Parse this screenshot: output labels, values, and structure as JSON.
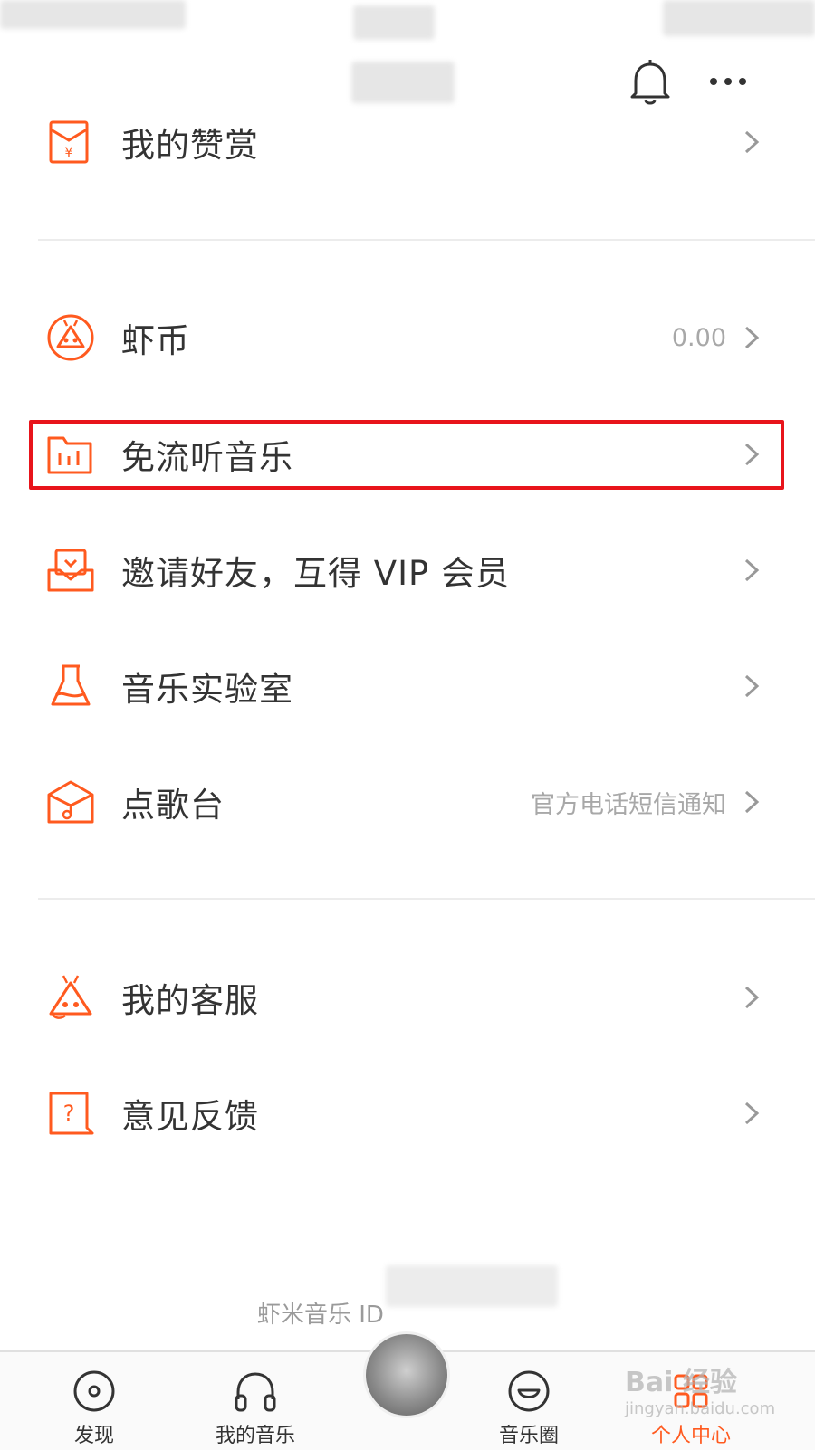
{
  "colors": {
    "accent": "#ff5a1f",
    "highlight": "#e8141b",
    "text": "#333333",
    "muted": "#a8a8a8"
  },
  "header": {
    "bell_icon": "bell-icon",
    "more_icon": "more-icon"
  },
  "menu": {
    "reward": {
      "label": "我的赞赏",
      "icon": "red-envelope-icon"
    },
    "coins": {
      "label": "虾币",
      "value": "0.00",
      "icon": "shrimp-coin-icon"
    },
    "free_data": {
      "label": "免流听音乐",
      "icon": "chart-folder-icon"
    },
    "invite": {
      "label": "邀请好友，互得 VIP 会员",
      "icon": "invite-icon"
    },
    "lab": {
      "label": "音乐实验室",
      "icon": "flask-icon"
    },
    "request": {
      "label": "点歌台",
      "value": "官方电话短信通知",
      "icon": "music-box-icon"
    },
    "service": {
      "label": "我的客服",
      "icon": "support-mascot-icon"
    },
    "feedback": {
      "label": "意见反馈",
      "icon": "question-bubble-icon"
    }
  },
  "footer": {
    "id_label": "虾米音乐 ID"
  },
  "tabs": [
    {
      "label": "发现",
      "icon": "disc-icon"
    },
    {
      "label": "我的音乐",
      "icon": "headphones-icon"
    },
    {
      "label": "",
      "icon": "album-cover"
    },
    {
      "label": "音乐圈",
      "icon": "smile-icon"
    },
    {
      "label": "个人中心",
      "icon": "profile-icon"
    }
  ],
  "watermark": {
    "line1": "Bai 经验",
    "line2": "jingyan.baidu.com"
  }
}
